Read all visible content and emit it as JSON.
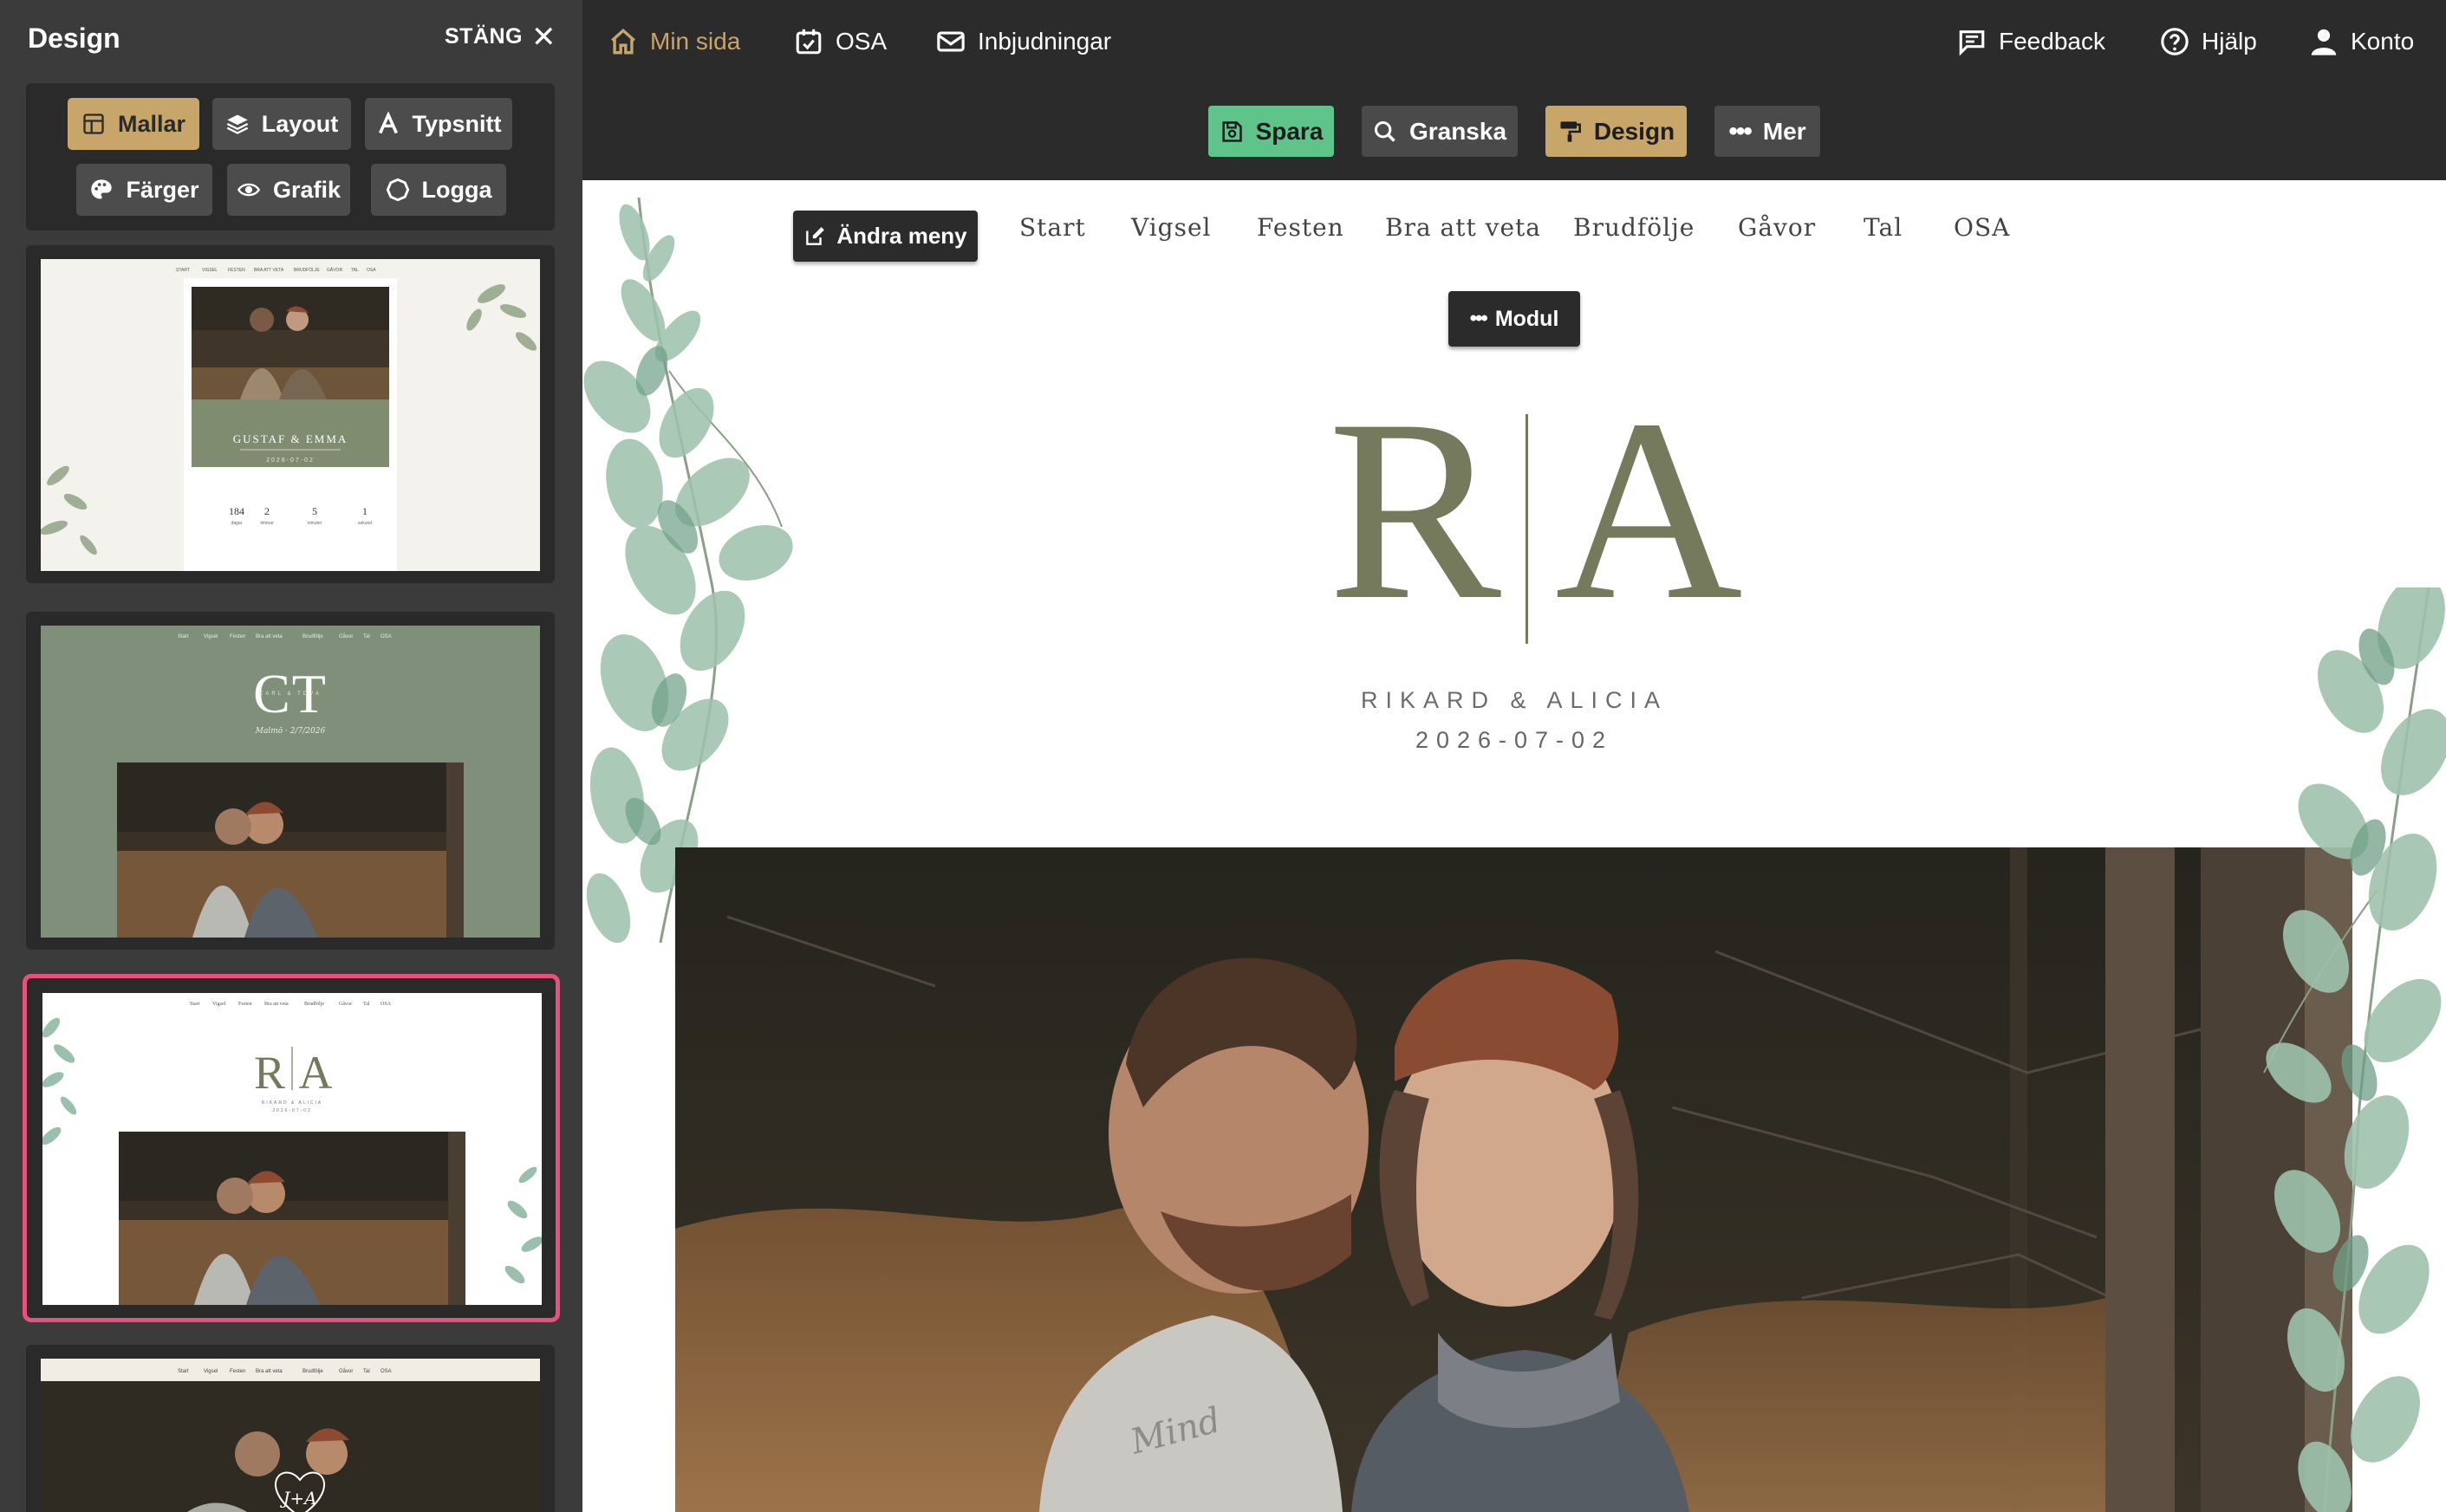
{
  "sidebar": {
    "title": "Design",
    "close_label": "STÄNG",
    "tools": [
      {
        "label": "Mallar",
        "icon": "template-icon",
        "active": true
      },
      {
        "label": "Layout",
        "icon": "layers-icon",
        "active": false
      },
      {
        "label": "Typsnitt",
        "icon": "font-icon",
        "active": false
      },
      {
        "label": "Färger",
        "icon": "palette-icon",
        "active": false
      },
      {
        "label": "Grafik",
        "icon": "graphics-icon",
        "active": false
      },
      {
        "label": "Logga",
        "icon": "logo-icon",
        "active": false
      }
    ],
    "templates": [
      {
        "title": "GUSTAF & EMMA",
        "date": "2026-07-02",
        "counters": [
          "184",
          "2",
          "5",
          "1"
        ],
        "counter_labels": [
          "dagar",
          "timmar",
          "minuter",
          "sekund"
        ],
        "menu": [
          "START",
          "VIGSEL",
          "FESTEN",
          "BRA ATT VETA",
          "BRUDFÖLJE",
          "GÅVOR",
          "TAL",
          "OSA"
        ],
        "selected": false
      },
      {
        "initials": "CT",
        "subtitle": "CARL & TOVA",
        "script": "Malmö · 2/7/2026",
        "menu": [
          "Start",
          "Vigsel",
          "Festen",
          "Bra att veta",
          "Brudfölje",
          "Gåvor",
          "Tal",
          "OSA"
        ],
        "selected": false
      },
      {
        "initials_left": "R",
        "initials_right": "A",
        "names": "RIKARD & ALICIA",
        "date": "2026-07-02",
        "menu": [
          "Start",
          "Vigsel",
          "Festen",
          "Bra att veta",
          "Brudfölje",
          "Gåvor",
          "Tal",
          "OSA"
        ],
        "selected": true
      },
      {
        "heart_text": "J+A",
        "menu": [
          "Start",
          "Vigsel",
          "Festen",
          "Bra att veta",
          "Brudfölje",
          "Gåvor",
          "Tal",
          "OSA"
        ],
        "selected": false
      }
    ]
  },
  "topnav": {
    "left": [
      {
        "label": "Min sida",
        "icon": "home-icon",
        "active": true
      },
      {
        "label": "OSA",
        "icon": "calendar-check-icon",
        "active": false
      },
      {
        "label": "Inbjudningar",
        "icon": "envelope-icon",
        "active": false
      }
    ],
    "right": [
      {
        "label": "Feedback",
        "icon": "feedback-icon"
      },
      {
        "label": "Hjälp",
        "icon": "help-icon"
      },
      {
        "label": "Konto",
        "icon": "user-icon"
      }
    ]
  },
  "toolbar": {
    "save": "Spara",
    "review": "Granska",
    "design": "Design",
    "more": "Mer"
  },
  "site": {
    "edit_menu": "Ändra meny",
    "menu": [
      "Start",
      "Vigsel",
      "Festen",
      "Bra att veta",
      "Brudfölje",
      "Gåvor",
      "Tal",
      "OSA"
    ],
    "module_label": "Modul",
    "initial_left": "R",
    "initial_right": "A",
    "names": "RIKARD & ALICIA",
    "date": "2026-07-02",
    "photo_print": "Mind"
  },
  "colors": {
    "accent_gold": "#c8a66a",
    "save_green": "#5fc489",
    "selected_pink": "#e9517d",
    "olive": "#767a5d",
    "sage_bg": "#7f8f7a"
  }
}
